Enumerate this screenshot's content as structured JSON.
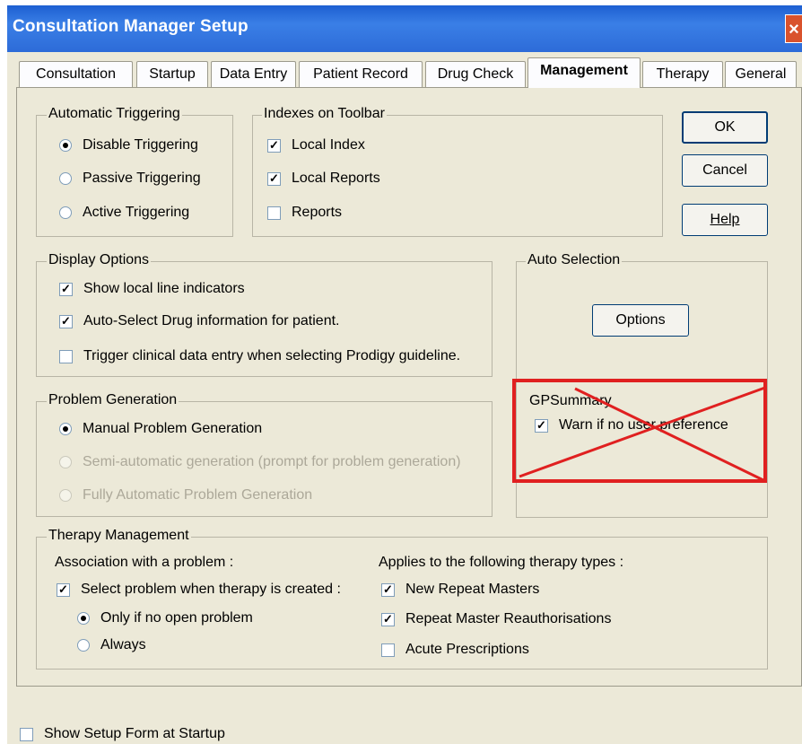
{
  "window": {
    "title": "Consultation Manager Setup",
    "close_label": "×"
  },
  "tabs": [
    {
      "label": "Consultation",
      "active": false
    },
    {
      "label": "Startup",
      "active": false
    },
    {
      "label": "Data Entry",
      "active": false
    },
    {
      "label": "Patient Record",
      "active": false
    },
    {
      "label": "Drug Check",
      "active": false
    },
    {
      "label": "Management",
      "active": true
    },
    {
      "label": "Therapy",
      "active": false
    },
    {
      "label": "General",
      "active": false
    }
  ],
  "automatic_triggering": {
    "label": "Automatic Triggering",
    "options": [
      {
        "label": "Disable Triggering",
        "selected": true
      },
      {
        "label": "Passive Triggering",
        "selected": false
      },
      {
        "label": "Active Triggering",
        "selected": false
      }
    ]
  },
  "indexes_on_toolbar": {
    "label": "Indexes on Toolbar",
    "items": [
      {
        "label": "Local Index",
        "checked": true
      },
      {
        "label": "Local Reports",
        "checked": true
      },
      {
        "label": "Reports",
        "checked": false
      }
    ]
  },
  "buttons": {
    "ok": "OK",
    "cancel": "Cancel",
    "help": "Help"
  },
  "display_options": {
    "label": "Display Options",
    "items": [
      {
        "label": "Show local line indicators",
        "checked": true
      },
      {
        "label": "Auto-Select Drug information for patient.",
        "checked": true
      },
      {
        "label": "Trigger clinical data entry when selecting Prodigy guideline.",
        "checked": false
      }
    ]
  },
  "auto_selection": {
    "label": "Auto Selection",
    "options_button": "Options"
  },
  "problem_generation": {
    "label": "Problem Generation",
    "options": [
      {
        "label": "Manual Problem Generation",
        "selected": true,
        "enabled": true
      },
      {
        "label": "Semi-automatic generation (prompt for problem generation)",
        "selected": false,
        "enabled": false
      },
      {
        "label": "Fully Automatic Problem Generation",
        "selected": false,
        "enabled": false
      }
    ]
  },
  "gp_summary": {
    "label": "GPSummary",
    "warn_label": "Warn if no user preference",
    "checked": true
  },
  "therapy_management": {
    "label": "Therapy Management",
    "association_label": "Association with a problem :",
    "select_problem_label": "Select problem when therapy is created :",
    "select_problem_checked": true,
    "only_if_label": "Only if no open problem",
    "always_label": "Always",
    "applies_label": "Applies to the following therapy types :",
    "types": [
      {
        "label": "New Repeat Masters",
        "checked": true
      },
      {
        "label": "Repeat Master Reauthorisations",
        "checked": true
      },
      {
        "label": "Acute Prescriptions",
        "checked": false
      }
    ]
  },
  "show_setup_form": {
    "label": "Show Setup Form at Startup",
    "checked": false
  },
  "colors": {
    "titlebar": "#2d6bd8",
    "annotation_cross": "#e02020"
  }
}
